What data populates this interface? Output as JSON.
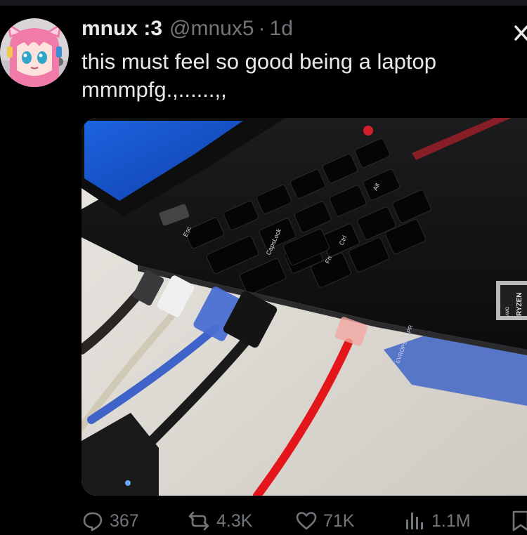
{
  "tweet": {
    "display_name": "mnux :3",
    "handle": "@mnux5",
    "separator": "·",
    "age": "1d",
    "text": "this must feel so good being a laptop\nmmmpfg.,......,,",
    "media": {
      "keyboard_keys": [
        "Esc",
        "CapsLock",
        "Ctrl",
        "Fn",
        "Alt"
      ],
      "badge_brand": "RYZEN",
      "badge_prefix": "AMD",
      "sticker_text": "EVROPSKY PR"
    }
  },
  "actions": {
    "replies": "367",
    "reposts": "4.3K",
    "likes": "71K",
    "views": "1.1M"
  },
  "icons": {
    "reply": "speech-bubble-icon",
    "repost": "repost-arrows-icon",
    "like": "heart-icon",
    "views": "bar-chart-icon",
    "bookmark": "bookmark-icon",
    "close": "close-icon"
  },
  "colors": {
    "background": "#000000",
    "primary_text": "#e7e9ea",
    "secondary_text": "#71767b",
    "avatar_hair": "#f07aa8",
    "laptop_body": "#161616",
    "screen": "#1556d6",
    "red_cable": "#e3161b",
    "blue_cable": "#3f63c8",
    "trackpoint": "#d2202a"
  }
}
